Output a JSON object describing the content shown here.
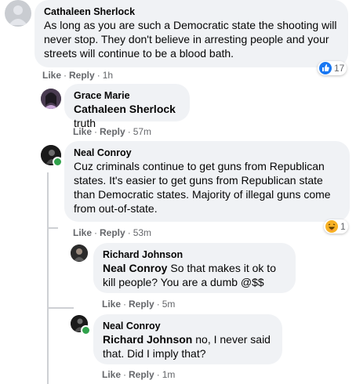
{
  "comments": [
    {
      "author": "Cathaleen Sherlock",
      "text": "As long as you are such a Democratic state the shooting will never stop. They don't believe in arresting people and your streets will continue to be a blood bath.",
      "like": "Like",
      "reply": "Reply",
      "time": "1h",
      "reaction_count": "17",
      "reaction_icon": "like-icon"
    },
    {
      "author": "Grace Marie",
      "mention": "Cathaleen Sherlock",
      "text": " truth",
      "like": "Like",
      "reply": "Reply",
      "time": "57m"
    },
    {
      "author": "Neal Conroy",
      "text": "Cuz criminals continue to get guns from Republican states. It's easier to get guns from Republican state than Democratic states. Majority of illegal guns come from out-of-state.",
      "like": "Like",
      "reply": "Reply",
      "time": "53m",
      "reaction_count": "1",
      "reaction_icon": "haha-icon"
    },
    {
      "author": "Richard Johnson",
      "mention": "Neal Conroy",
      "text": " So that makes it ok to kill people? You are a dumb @$$",
      "like": "Like",
      "reply": "Reply",
      "time": "5m"
    },
    {
      "author": "Neal Conroy",
      "mention": "Richard Johnson",
      "text": " no, I never said that. Did I imply that?",
      "like": "Like",
      "reply": "Reply",
      "time": "1m"
    }
  ],
  "colors": {
    "bubble": "#f0f2f5",
    "meta": "#65676b",
    "like_blue": "#1877f2",
    "online": "#31a24c"
  }
}
